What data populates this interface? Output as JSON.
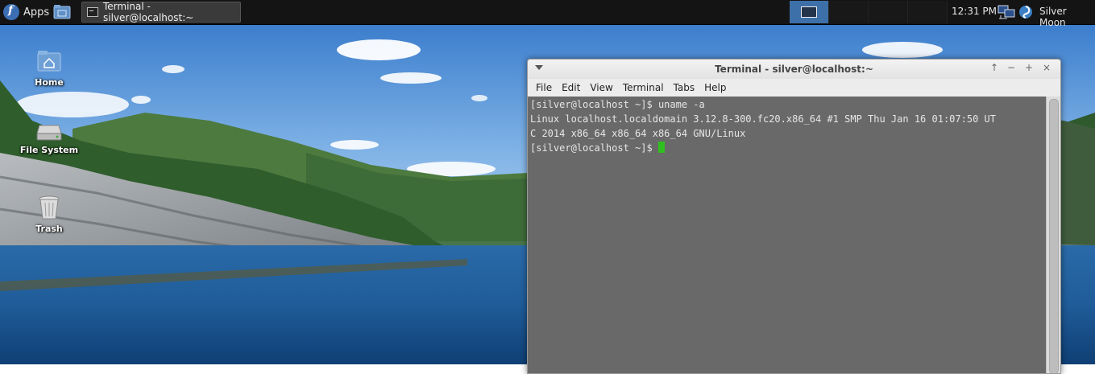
{
  "panel": {
    "apps_label": "Apps",
    "task_label": "Terminal - silver@localhost:~",
    "clock": "12:31 PM",
    "user": "Silver Moon"
  },
  "desktop": {
    "icons": [
      {
        "label": "Home"
      },
      {
        "label": "File System"
      },
      {
        "label": "Trash"
      }
    ]
  },
  "terminal": {
    "title": "Terminal - silver@localhost:~",
    "menu": [
      "File",
      "Edit",
      "View",
      "Terminal",
      "Tabs",
      "Help"
    ],
    "lines": [
      "[silver@localhost ~]$ uname -a",
      "Linux localhost.localdomain 3.12.8-300.fc20.x86_64 #1 SMP Thu Jan 16 01:07:50 UT",
      "C 2014 x86_64 x86_64 x86_64 GNU/Linux",
      "[silver@localhost ~]$ "
    ]
  },
  "colors": {
    "cursor": "#2fbf1f",
    "active_workspace": "#3d6fa8",
    "panel_bg": "#141414"
  }
}
